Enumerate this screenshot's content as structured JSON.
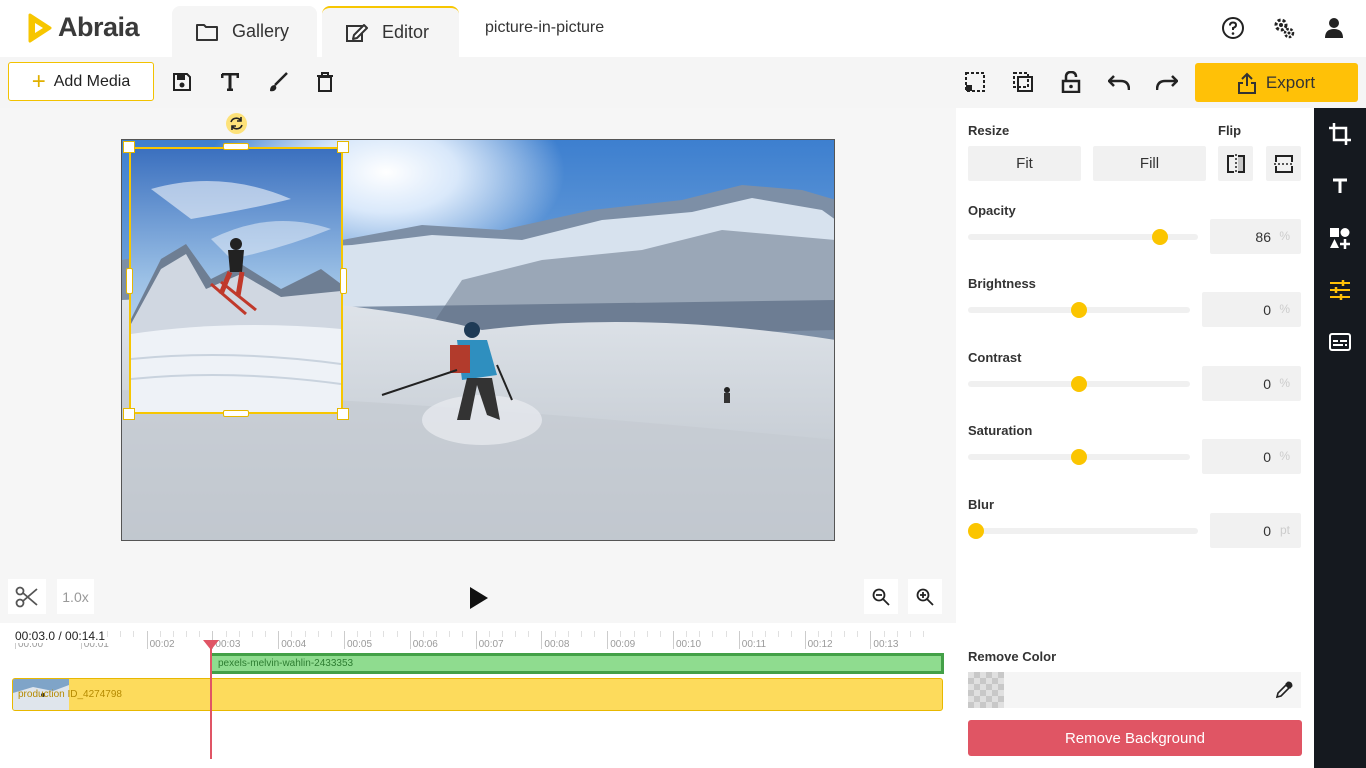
{
  "app": {
    "name": "Abraia",
    "tabs": [
      {
        "label": "Gallery",
        "icon": "folder-icon"
      },
      {
        "label": "Editor",
        "icon": "edit-icon"
      }
    ],
    "document_title": "picture-in-picture",
    "header_icons": [
      "help-icon",
      "settings-icon",
      "user-icon"
    ]
  },
  "toolbar": {
    "add_media_label": "Add Media",
    "export_label": "Export",
    "left_icons": [
      "save-icon",
      "text-icon",
      "brush-icon",
      "trash-icon"
    ],
    "right_icons": [
      "select-icon",
      "duplicate-icon",
      "lock-icon",
      "undo-icon",
      "redo-icon"
    ]
  },
  "timeline": {
    "speed": "1.0x",
    "time_readout": "00:03.0 / 00:14.1",
    "ruler_labels": [
      "00:00",
      "00:01",
      "00:02",
      "00:03",
      "00:04",
      "00:05",
      "00:06",
      "00:07",
      "00:08",
      "00:09",
      "00:10",
      "00:11",
      "00:12",
      "00:13"
    ],
    "tracks": [
      {
        "label": "pexels-melvin-wahlin-2433353",
        "color": "#8fdc8f"
      },
      {
        "label": "production ID_4274798",
        "color": "#fddb5c"
      }
    ],
    "playhead_time": "00:03.0"
  },
  "panel": {
    "resize_label": "Resize",
    "flip_label": "Flip",
    "fit_label": "Fit",
    "fill_label": "Fill",
    "sliders": [
      {
        "label": "Opacity",
        "value": "86",
        "unit": "%",
        "fraction": 0.86
      },
      {
        "label": "Brightness",
        "value": "0",
        "unit": "%",
        "fraction": 0.5
      },
      {
        "label": "Contrast",
        "value": "0",
        "unit": "%",
        "fraction": 0.5
      },
      {
        "label": "Saturation",
        "value": "0",
        "unit": "%",
        "fraction": 0.5
      },
      {
        "label": "Blur",
        "value": "0",
        "unit": "pt",
        "fraction": 0.0
      }
    ],
    "remove_color_label": "Remove Color",
    "remove_background_label": "Remove Background"
  },
  "rail_icons": [
    "crop-icon",
    "text-tool-icon",
    "shapes-icon",
    "adjust-icon",
    "subtitles-icon"
  ],
  "colors": {
    "accent": "#ffc107",
    "danger": "#e05564",
    "rail": "#15191f"
  }
}
